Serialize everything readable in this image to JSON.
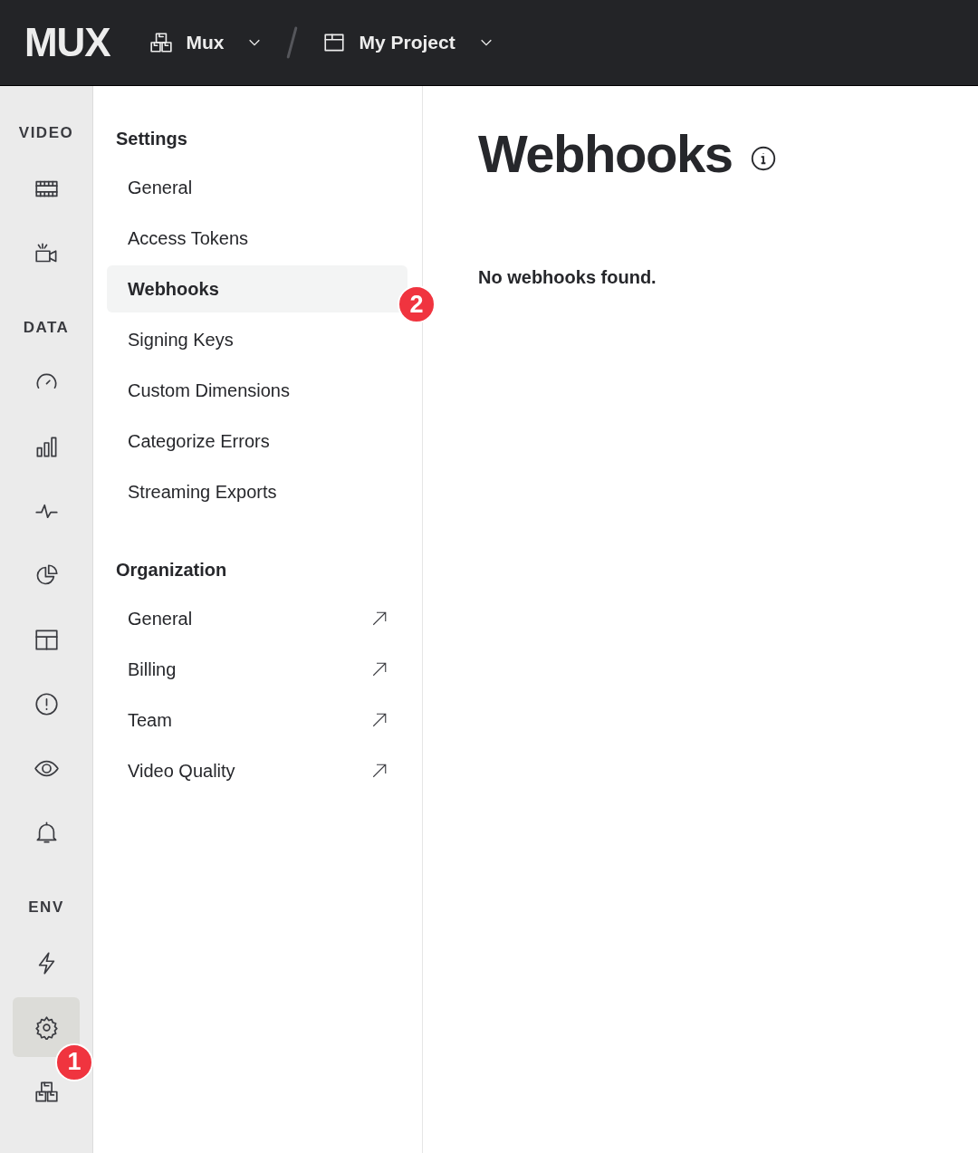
{
  "topbar": {
    "logo": "MUX",
    "breadcrumbs": [
      {
        "label": "Mux",
        "kind": "boxes"
      },
      {
        "label": "My Project",
        "kind": "box"
      }
    ]
  },
  "rail": [
    {
      "label": "VIDEO",
      "items": [
        {
          "kind": "film",
          "selected": false
        },
        {
          "kind": "camera",
          "selected": false
        }
      ]
    },
    {
      "label": "DATA",
      "items": [
        {
          "kind": "gauge",
          "selected": false
        },
        {
          "kind": "bars",
          "selected": false
        },
        {
          "kind": "pulse",
          "selected": false
        },
        {
          "kind": "pie",
          "selected": false
        },
        {
          "kind": "layout",
          "selected": false
        },
        {
          "kind": "alert",
          "selected": false
        },
        {
          "kind": "eye",
          "selected": false
        },
        {
          "kind": "bell",
          "selected": false
        }
      ]
    },
    {
      "label": "ENV",
      "items": [
        {
          "kind": "bolt",
          "selected": false
        },
        {
          "kind": "gear",
          "selected": true,
          "badge": "1"
        },
        {
          "kind": "boxes",
          "selected": false
        }
      ]
    }
  ],
  "settings_nav": [
    {
      "heading": "Settings",
      "items": [
        {
          "label": "General",
          "selected": false,
          "external": false
        },
        {
          "label": "Access Tokens",
          "selected": false,
          "external": false
        },
        {
          "label": "Webhooks",
          "selected": true,
          "external": false,
          "badge": "2"
        },
        {
          "label": "Signing Keys",
          "selected": false,
          "external": false
        },
        {
          "label": "Custom Dimensions",
          "selected": false,
          "external": false
        },
        {
          "label": "Categorize Errors",
          "selected": false,
          "external": false
        },
        {
          "label": "Streaming Exports",
          "selected": false,
          "external": false
        }
      ]
    },
    {
      "heading": "Organization",
      "items": [
        {
          "label": "General",
          "selected": false,
          "external": true
        },
        {
          "label": "Billing",
          "selected": false,
          "external": true
        },
        {
          "label": "Team",
          "selected": false,
          "external": true
        },
        {
          "label": "Video Quality",
          "selected": false,
          "external": true
        }
      ]
    }
  ],
  "main": {
    "title": "Webhooks",
    "empty_message": "No webhooks found."
  }
}
